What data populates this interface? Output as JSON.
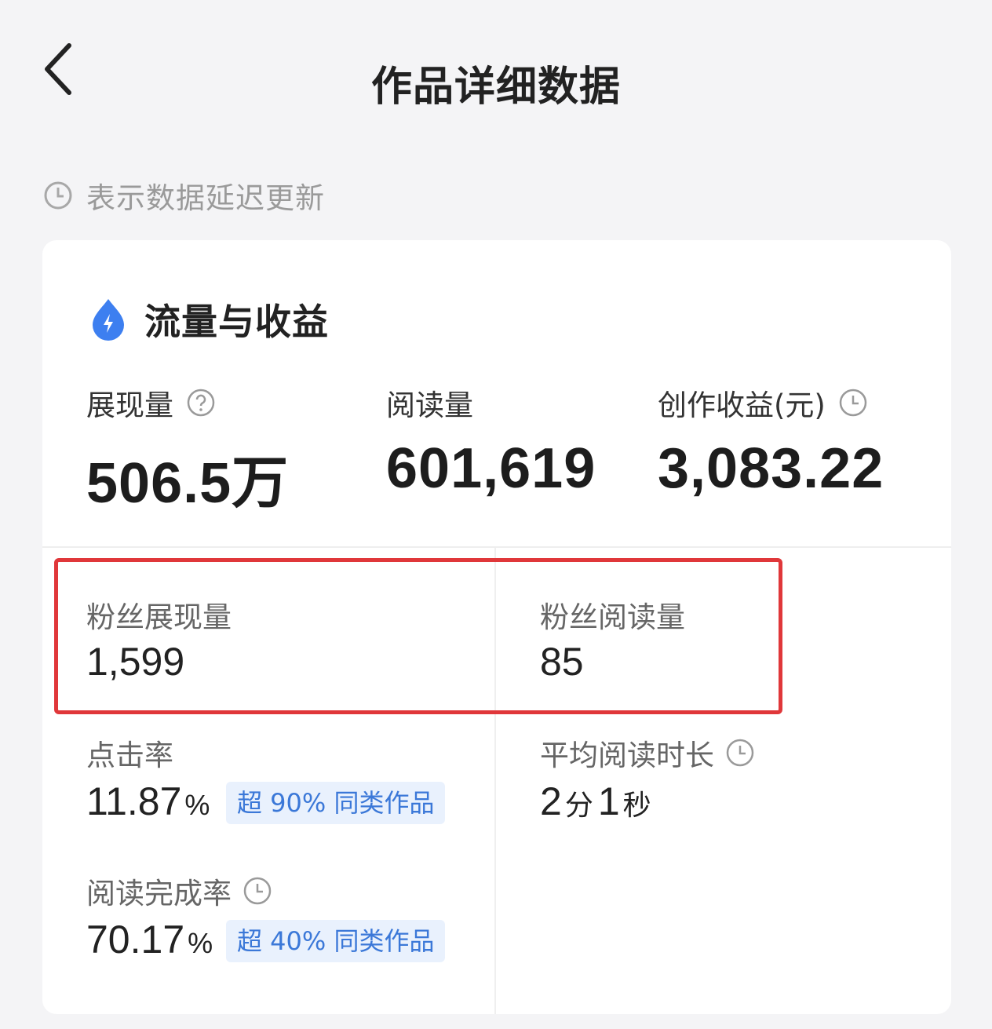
{
  "header": {
    "title": "作品详细数据",
    "back_icon": "chevron-left-icon"
  },
  "notice": {
    "icon": "clock-icon",
    "text": "表示数据延迟更新"
  },
  "card": {
    "title": "流量与收益",
    "title_icon": "lightning-drop-icon",
    "accent_color": "#3d7ff0",
    "main_metrics": [
      {
        "label": "展现量",
        "value": "506.5万",
        "icon": "help-circle-icon"
      },
      {
        "label": "阅读量",
        "value": "601,619"
      },
      {
        "label": "创作收益(元)",
        "value": "3,083.22",
        "icon": "clock-icon"
      }
    ],
    "fan_metrics": [
      {
        "label": "粉丝展现量",
        "value": "1,599"
      },
      {
        "label": "粉丝阅读量",
        "value": "85"
      }
    ],
    "click_rate": {
      "label": "点击率",
      "value": "11.87",
      "unit": "%",
      "badge": "超 90% 同类作品"
    },
    "avg_read_time": {
      "label": "平均阅读时长",
      "icon": "clock-icon",
      "minutes": "2",
      "minutes_unit": "分",
      "seconds": "1",
      "seconds_unit": "秒"
    },
    "completion_rate": {
      "label": "阅读完成率",
      "icon": "clock-icon",
      "value": "70.17",
      "unit": "%",
      "badge": "超 40% 同类作品"
    }
  },
  "highlight_color": "#e0373a"
}
